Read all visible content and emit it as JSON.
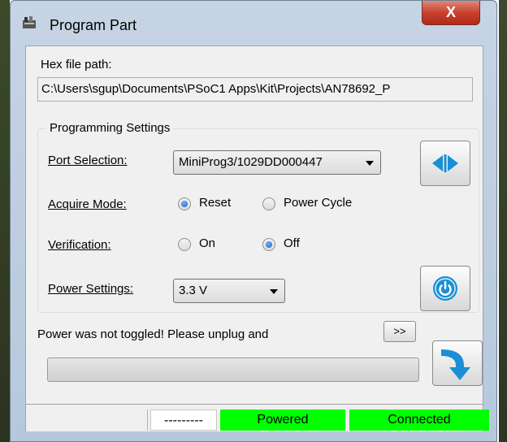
{
  "window": {
    "title": "Program Part",
    "close_glyph": "X"
  },
  "hex": {
    "label": "Hex file path:",
    "path": "C:\\Users\\sgup\\Documents\\PSoC1 Apps\\Kit\\Projects\\AN78692_P"
  },
  "settings": {
    "group_title": "Programming Settings",
    "port": {
      "label": "Port Selection:",
      "value": "MiniProg3/1029DD000447"
    },
    "acquire": {
      "label": "Acquire Mode:",
      "options": [
        "Reset",
        "Power Cycle"
      ],
      "selected": "Reset"
    },
    "verification": {
      "label": "Verification:",
      "options": [
        "On",
        "Off"
      ],
      "selected": "Off"
    },
    "power": {
      "label": "Power Settings:",
      "value": "3.3 V"
    }
  },
  "status_message": "Power was not toggled! Please unplug and",
  "expand_label": ">>",
  "progress": {
    "percent": 0
  },
  "statusbar": {
    "cell1": "---------",
    "powered": "Powered",
    "connected": "Connected"
  },
  "colors": {
    "accent_blue": "#1a8fd6",
    "status_green": "#00ff00",
    "close_red": "#c8412f"
  }
}
